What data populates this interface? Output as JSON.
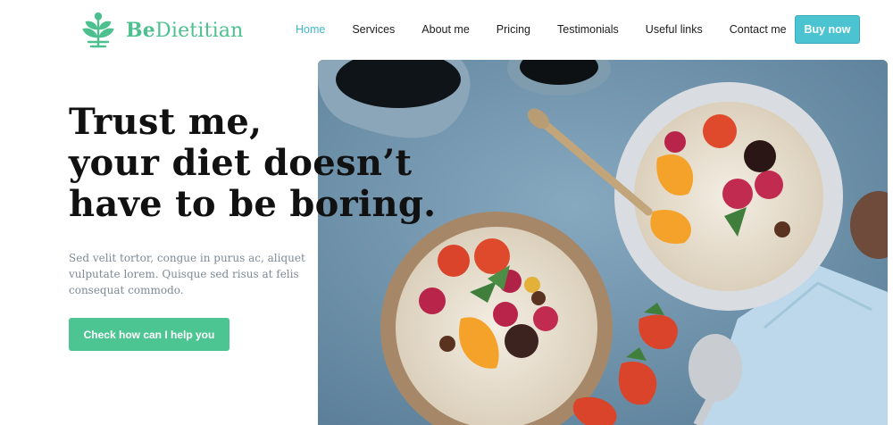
{
  "brand": {
    "name_bold": "Be",
    "name_rest": "Dietitian",
    "logo_icon": "leaf-plant-icon",
    "color": "#4ec08f"
  },
  "nav": {
    "items": [
      {
        "label": "Home",
        "active": true
      },
      {
        "label": "Services",
        "active": false
      },
      {
        "label": "About me",
        "active": false
      },
      {
        "label": "Pricing",
        "active": false
      },
      {
        "label": "Testimonials",
        "active": false
      },
      {
        "label": "Useful links",
        "active": false
      },
      {
        "label": "Contact me",
        "active": false
      }
    ],
    "active_color": "#3fb8cc"
  },
  "header": {
    "buy_label": "Buy now",
    "buy_color": "#4cc3d1"
  },
  "hero": {
    "headline_lines": [
      "Trust me,",
      "your diet doesn’t",
      "have to be boring."
    ],
    "subtext": "Sed velit tortor, congue in purus ac, aliquet vulputate lorem. Quisque sed risus at felis consequat commodo.",
    "cta_label": "Check how can I help you",
    "cta_color": "#4cc592"
  }
}
